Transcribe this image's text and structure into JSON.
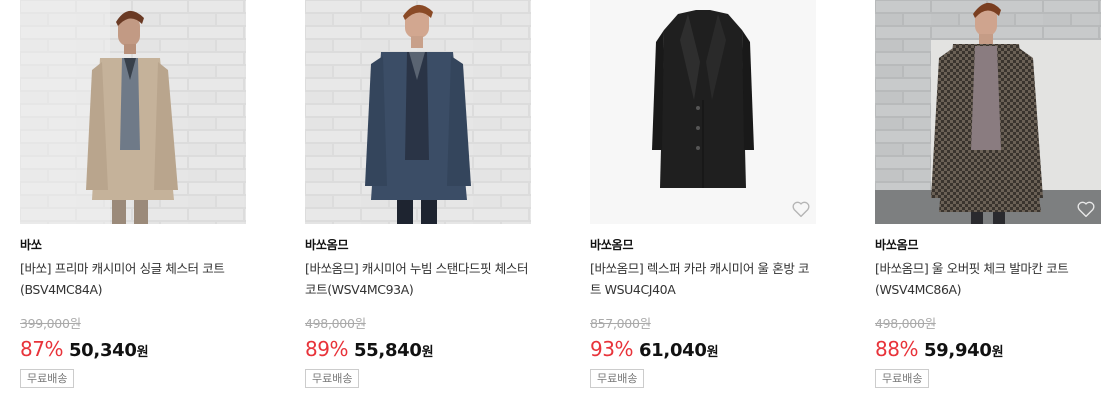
{
  "products": [
    {
      "brand": "바쏘",
      "title": "[바쏘] 프리마 캐시미어 싱글 체스터 코트 (BSV4MC84A)",
      "original_price": "399,000원",
      "discount": "87%",
      "price": "50,340",
      "currency": "원",
      "badge": "무료배송",
      "image": "beige-chester-coat-model",
      "wishlist_icon": "heart-outline-icon",
      "wishlist_visible": false
    },
    {
      "brand": "바쏘옴므",
      "title": "[바쏘옴므] 캐시미어 누빔 스탠다드핏 체스터 코트(WSV4MC93A)",
      "original_price": "498,000원",
      "discount": "89%",
      "price": "55,840",
      "currency": "원",
      "badge": "무료배송",
      "image": "navy-chester-coat-model",
      "wishlist_icon": "heart-outline-icon",
      "wishlist_visible": false
    },
    {
      "brand": "바쏘옴므",
      "title": "[바쏘옴므] 렉스퍼 카라 캐시미어 울 혼방 코트 WSU4CJ40A",
      "original_price": "857,000원",
      "discount": "93%",
      "price": "61,040",
      "currency": "원",
      "badge": "무료배송",
      "image": "black-long-coat-flat",
      "wishlist_icon": "heart-outline-icon",
      "wishlist_visible": true
    },
    {
      "brand": "바쏘옴므",
      "title": "[바쏘옴므] 울 오버핏 체크 발마칸 코트 (WSV4MC86A)",
      "original_price": "498,000원",
      "discount": "88%",
      "price": "59,940",
      "currency": "원",
      "badge": "무료배송",
      "image": "check-balmacaan-coat-model",
      "wishlist_icon": "heart-outline-icon",
      "wishlist_visible": true
    }
  ],
  "colors": {
    "discount": "#e8333a",
    "original_price": "#aaaaaa",
    "badge_border": "#cccccc",
    "badge_text": "#777777"
  }
}
